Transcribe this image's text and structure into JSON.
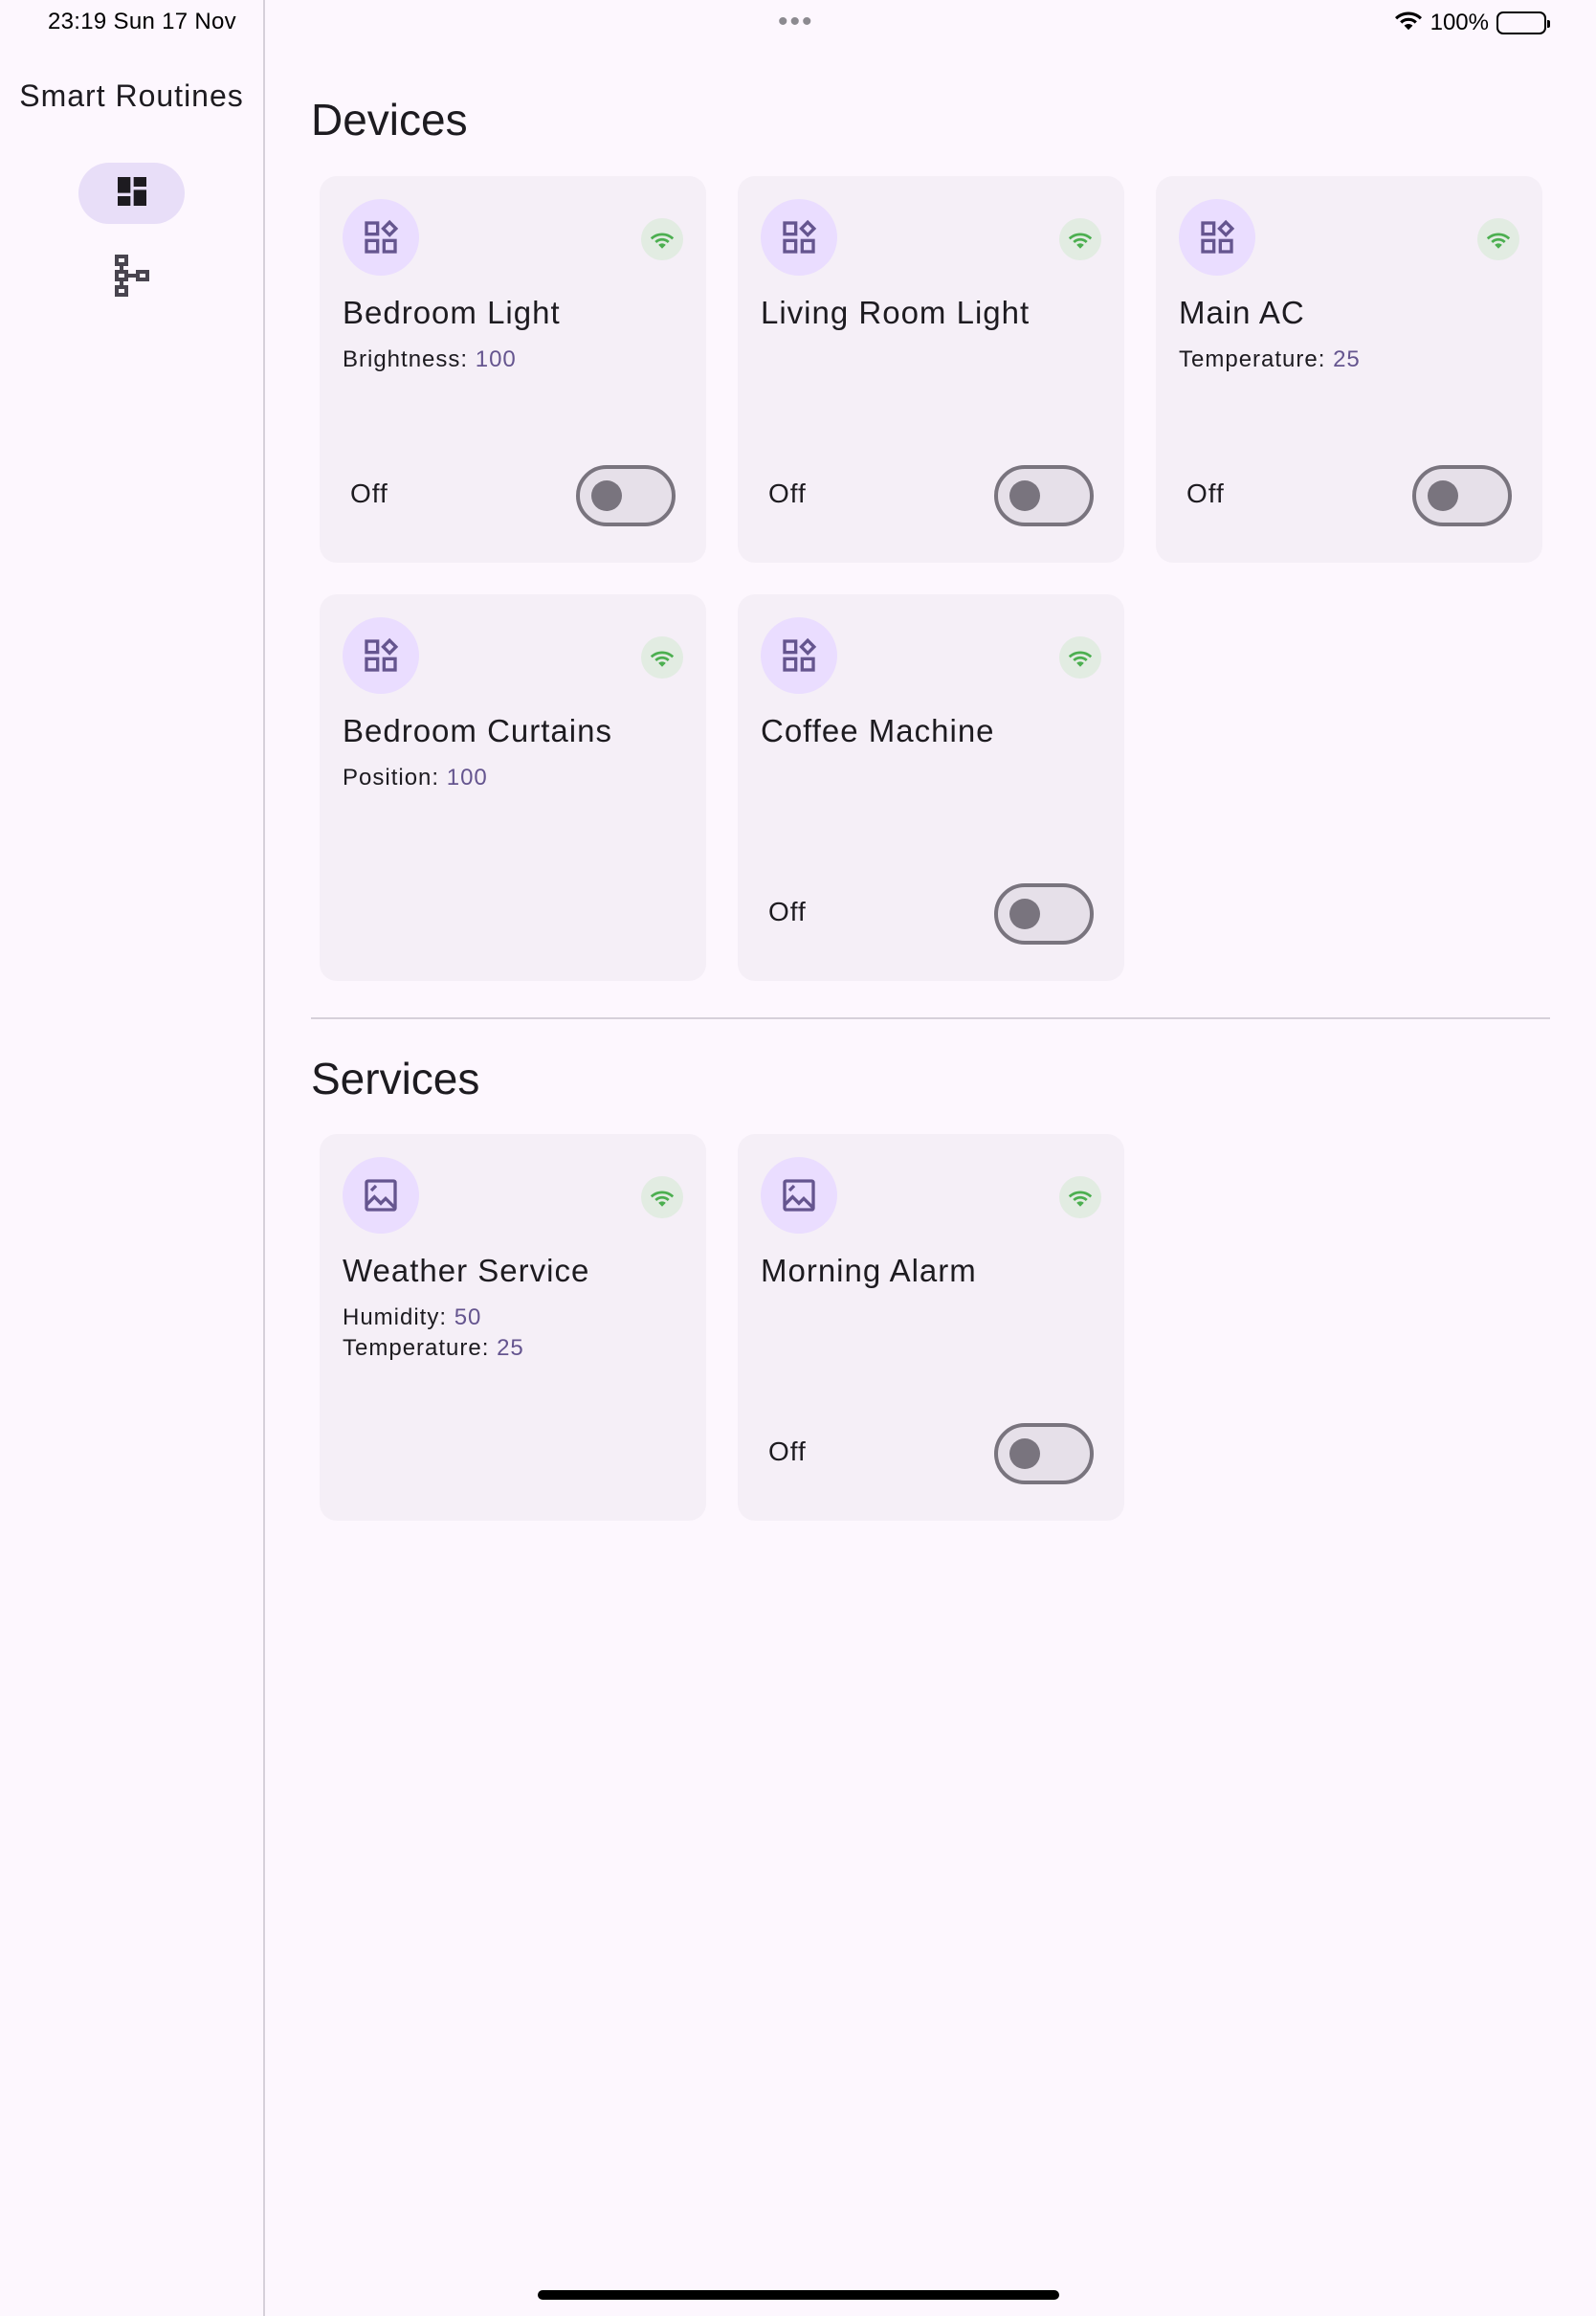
{
  "status_bar": {
    "time_date": "23:19   Sun 17 Nov",
    "dots": "•••",
    "battery_text": "100%"
  },
  "rail": {
    "title": "Smart Routines",
    "items": [
      {
        "name": "dashboard",
        "active": true
      },
      {
        "name": "routines",
        "active": false
      }
    ]
  },
  "sections": {
    "devices_title": "Devices",
    "services_title": "Services"
  },
  "devices": [
    {
      "name": "Bedroom Light",
      "attrs": [
        {
          "label": "Brightness: ",
          "value": "100"
        }
      ],
      "state": "Off",
      "toggle_on": false,
      "icon": "widgets-icon"
    },
    {
      "name": "Living Room Light",
      "attrs": [],
      "state": "Off",
      "toggle_on": false,
      "icon": "widgets-icon"
    },
    {
      "name": "Main AC",
      "attrs": [
        {
          "label": "Temperature: ",
          "value": "25"
        }
      ],
      "state": "Off",
      "toggle_on": false,
      "icon": "widgets-icon"
    },
    {
      "name": "Bedroom Curtains",
      "attrs": [
        {
          "label": "Position: ",
          "value": "100"
        }
      ],
      "state": "",
      "toggle_on": null,
      "icon": "widgets-icon"
    },
    {
      "name": "Coffee Machine",
      "attrs": [],
      "state": "Off",
      "toggle_on": false,
      "icon": "widgets-icon"
    }
  ],
  "services": [
    {
      "name": "Weather Service",
      "attrs": [
        {
          "label": "Humidity: ",
          "value": "50"
        },
        {
          "label": "Temperature: ",
          "value": "25"
        }
      ],
      "state": "",
      "toggle_on": null,
      "icon": "image-icon"
    },
    {
      "name": "Morning Alarm",
      "attrs": [],
      "state": "Off",
      "toggle_on": false,
      "icon": "image-icon"
    }
  ],
  "colors": {
    "background": "#fdf7fe",
    "card": "#f5eff7",
    "accent": "#65558f",
    "icon_bg": "#eaddff",
    "online": "#4caf50"
  }
}
